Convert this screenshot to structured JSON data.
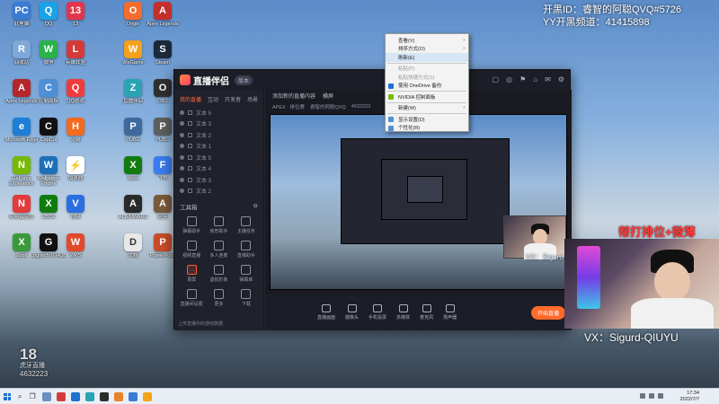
{
  "overlay": {
    "streamer_id": "开黑ID：睿智的阿聪QVQ#5726",
    "yy_channel": "YY开黑频道：41415898",
    "rank_banner": "帮打排位+微薄",
    "vx_main": "VX：Sigurd-QIUYU",
    "vx_small": "VX：Sigurd-QIUYU"
  },
  "desktop_icons": [
    {
      "label": "此电脑",
      "color": "#3a7bd5",
      "glyph": "PC"
    },
    {
      "label": "QQ",
      "color": "#1aa3e8",
      "glyph": "Q"
    },
    {
      "label": "13",
      "color": "#e3344b",
      "glyph": "13"
    },
    {
      "label": "Origin",
      "color": "#f56c2d",
      "glyph": "O"
    },
    {
      "label": "Apex Legends",
      "color": "#c3302b",
      "glyph": "A"
    },
    {
      "label": "回收站",
      "color": "#7ea8d8",
      "glyph": "R"
    },
    {
      "label": "微信",
      "color": "#2bb24c",
      "glyph": "W"
    },
    {
      "label": "英雄联盟",
      "color": "#d43a3a",
      "glyph": "L"
    },
    {
      "label": "WeGame",
      "color": "#f4a11c",
      "glyph": "W"
    },
    {
      "label": "Steam",
      "color": "#1b2838",
      "glyph": "S"
    },
    {
      "label": "Apex Legends",
      "color": "#b3262b",
      "glyph": "A"
    },
    {
      "label": "控制面板",
      "color": "#4f8fd6",
      "glyph": "C"
    },
    {
      "label": "QQ游戏",
      "color": "#f03b3b",
      "glyph": "Q"
    },
    {
      "label": "直播伴侣",
      "color": "#2aa3b5",
      "glyph": "Z"
    },
    {
      "label": "OBS",
      "color": "#303030",
      "glyph": "O"
    },
    {
      "label": "Microsoft Edge",
      "color": "#1c7ed6",
      "glyph": "e"
    },
    {
      "label": "CapCut",
      "color": "#111111",
      "glyph": "C"
    },
    {
      "label": "火绒",
      "color": "#f46a1f",
      "glyph": "H"
    },
    {
      "label": "PUBG",
      "color": "#3d6a9c",
      "glyph": "P"
    },
    {
      "label": "PUBG",
      "color": "#5f5f5f",
      "glyph": "P"
    },
    {
      "label": "GeForce Experience",
      "color": "#76b900",
      "glyph": "N"
    },
    {
      "label": "Wallpaper Engine",
      "color": "#1d6fb8",
      "glyph": "W"
    },
    {
      "label": "加速器",
      "color": "#ffffff",
      "glyph": "⚡"
    },
    {
      "label": "Xbox",
      "color": "#107c10",
      "glyph": "X"
    },
    {
      "label": "飞书",
      "color": "#3b7cf0",
      "glyph": "F"
    },
    {
      "label": "网易云音乐",
      "color": "#e23b3b",
      "glyph": "N"
    },
    {
      "label": "XBOX",
      "color": "#107c10",
      "glyph": "X"
    },
    {
      "label": "视频",
      "color": "#2b6ee0",
      "glyph": "V"
    },
    {
      "label": "ALIENWARE",
      "color": "#2a2a2a",
      "glyph": "A"
    },
    {
      "label": "应用",
      "color": "#7a5a3c",
      "glyph": "A"
    },
    {
      "label": "Xbox",
      "color": "#3a9a3a",
      "glyph": "X"
    },
    {
      "label": "Logitech G HUB",
      "color": "#111111",
      "glyph": "G"
    },
    {
      "label": "WPS",
      "color": "#e04a2b",
      "glyph": "W"
    },
    {
      "label": "文档",
      "color": "#e8e8e8",
      "glyph": "D"
    },
    {
      "label": "PowerPoint",
      "color": "#c94c2b",
      "glyph": "P"
    }
  ],
  "app": {
    "logo_text": "直播伴侣",
    "version": "版本",
    "title_icons": [
      "▢",
      "◎",
      "⚑",
      "⌂",
      "✉",
      "⚙"
    ],
    "side_tabs": [
      "我的直播",
      "互动",
      "开发者",
      "场景"
    ],
    "scenes": [
      "文本 5",
      "文本 3",
      "文本 2",
      "文本 1",
      "文本 5",
      "文本 4",
      "文本 3",
      "文本 2"
    ],
    "tools_title": "工具箱",
    "tools": [
      "弹幕助手",
      "房管助手",
      "主播任务",
      "视频直播",
      "多人连麦",
      "直播助手",
      "录屏",
      "虚拟形象",
      "弹幕库",
      "直播间设置",
      "更多",
      "下载"
    ],
    "sidebar_footer": "上传直播中的游戏数据",
    "preview_header": [
      "添加新的直播内容",
      "横屏"
    ],
    "preview_sub": [
      "APEX · 排位赛",
      "睿智的阿聪QVQ",
      "4632223"
    ],
    "bottom_buttons": [
      "直播画面",
      "摄像头",
      "手机投屏",
      "多媒体",
      "麦克风",
      "扬声器"
    ],
    "start_live": "开始直播"
  },
  "context_menu": [
    {
      "label": "查看(V)",
      "state": "normal",
      "arrow": true
    },
    {
      "label": "排序方式(O)",
      "state": "normal",
      "arrow": true
    },
    {
      "label": "刷新(E)",
      "state": "hover",
      "arrow": false
    },
    {
      "sep": true
    },
    {
      "label": "粘贴(P)",
      "state": "disabled",
      "arrow": false
    },
    {
      "label": "粘贴快捷方式(S)",
      "state": "disabled",
      "arrow": false
    },
    {
      "label": "使用 OneDrive 备份",
      "state": "normal",
      "arrow": false,
      "icon": "#1a73d1"
    },
    {
      "sep": true
    },
    {
      "label": "NVIDIA 控制面板",
      "state": "normal",
      "arrow": false,
      "icon": "#76b900"
    },
    {
      "sep": true
    },
    {
      "label": "新建(W)",
      "state": "normal",
      "arrow": true
    },
    {
      "sep": true
    },
    {
      "label": "显示设置(D)",
      "state": "normal",
      "arrow": false,
      "icon": "#4f8fd6"
    },
    {
      "label": "个性化(R)",
      "state": "normal",
      "arrow": false,
      "icon": "#4f8fd6"
    }
  ],
  "watermark": {
    "big": "18",
    "mid": "虎牙直播",
    "num": "4632223"
  },
  "taskbar": {
    "time": "17:34",
    "date": "2022/7/7",
    "apps": [
      "#6b8fbf",
      "#d23b3b",
      "#1a73d1",
      "#2aa3b5",
      "#2d2d2d",
      "#e9802b",
      "#3a7bd5",
      "#f3a21c"
    ]
  }
}
